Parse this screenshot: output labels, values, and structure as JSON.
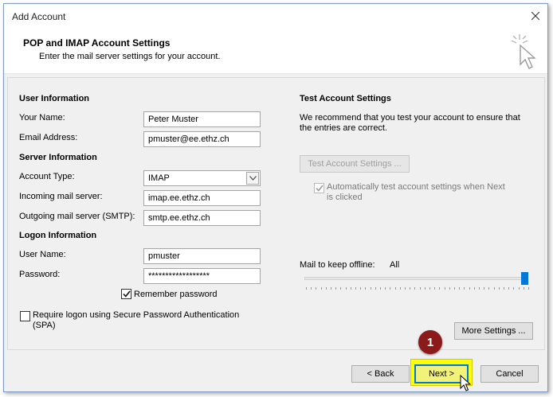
{
  "window": {
    "title": "Add Account"
  },
  "header": {
    "title": "POP and IMAP Account Settings",
    "subtitle": "Enter the mail server settings for your account."
  },
  "user_info": {
    "section": "User Information",
    "name_label": "Your Name:",
    "name_value": "Peter Muster",
    "email_label": "Email Address:",
    "email_value": "pmuster@ee.ethz.ch"
  },
  "server_info": {
    "section": "Server Information",
    "account_type_label": "Account Type:",
    "account_type_value": "IMAP",
    "incoming_label": "Incoming mail server:",
    "incoming_value": "imap.ee.ethz.ch",
    "outgoing_label": "Outgoing mail server (SMTP):",
    "outgoing_value": "smtp.ee.ethz.ch"
  },
  "logon_info": {
    "section": "Logon Information",
    "username_label": "User Name:",
    "username_value": "pmuster",
    "password_label": "Password:",
    "password_value": "******************",
    "remember_label": "Remember password",
    "remember_checked": true,
    "spa_label_line1": "Require logon using Secure Password Authentication",
    "spa_label_line2": "(SPA)",
    "spa_checked": false
  },
  "test_settings": {
    "section": "Test Account Settings",
    "desc_line1": "We recommend that you test your account to ensure that",
    "desc_line2": "the entries are correct.",
    "test_button": "Test Account Settings ...",
    "auto_test_line1": "Automatically test account settings when Next",
    "auto_test_line2": "is clicked",
    "auto_test_checked": true,
    "offline_label": "Mail to keep offline:",
    "offline_value": "All",
    "offline_slider_fraction": 1.0
  },
  "buttons": {
    "more_settings": "More Settings ...",
    "back": "< Back",
    "next": "Next >",
    "cancel": "Cancel"
  },
  "annotation": {
    "step": "1"
  },
  "colors": {
    "accent": "#0078d7",
    "highlight": "#ffff00",
    "badge": "#8b1a1a",
    "panel_bg": "#f0f0f0"
  },
  "icons": {
    "close": "close-icon",
    "header": "click-cursor-icon",
    "dropdown": "chevron-down-icon",
    "check": "check-icon",
    "pointer": "mouse-pointer-icon"
  }
}
